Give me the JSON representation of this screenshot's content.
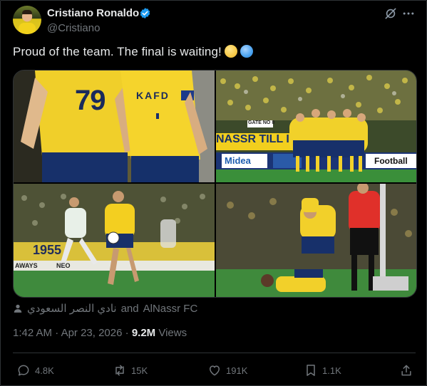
{
  "author": {
    "name": "Cristiano Ronaldo",
    "handle": "@Cristiano",
    "verified": true
  },
  "header_icons": [
    "grok-icon",
    "more-options-icon"
  ],
  "tweet": {
    "text": "Proud of the team. The final is waiting!",
    "emojis": [
      "yellow-heart-circle",
      "blue-heart-circle"
    ]
  },
  "media": {
    "photos": [
      {
        "subject": "players-back-jerseys",
        "jersey_number": "79",
        "sponsor": "KAFD"
      },
      {
        "subject": "team-huddle",
        "banner_text": "NASSR TILL I",
        "sign": "GATE NO 8",
        "ads": [
          "Midea",
          "Football"
        ]
      },
      {
        "subject": "player-dribbling",
        "board_text": "1955",
        "ads": [
          "AWAYS",
          "NEO"
        ]
      },
      {
        "subject": "players-celebrating-referee"
      }
    ]
  },
  "tagged": {
    "arabic": "نادي النصر السعودي",
    "conjunction": "and",
    "other": "AlNassr FC"
  },
  "meta": {
    "time": "1:42 AM",
    "separator": "·",
    "date": "Apr 23, 2026",
    "views_count": "9.2M",
    "views_label": "Views"
  },
  "actions": {
    "reply": "4.8K",
    "retweet": "15K",
    "like": "191K",
    "bookmark": "1.1K"
  },
  "colors": {
    "background": "#000000",
    "text": "#e7e9ea",
    "secondary": "#71767b",
    "border": "#2f3336",
    "verified": "#1d9bf0",
    "nassr_yellow": "#f2d21c",
    "nassr_blue": "#16306b"
  }
}
